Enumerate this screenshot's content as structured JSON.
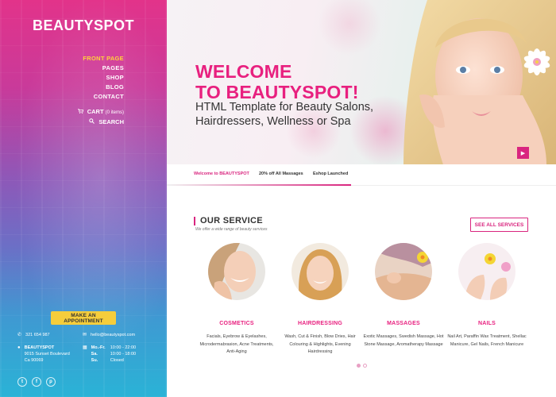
{
  "brand": "BEAUTYSPOT",
  "menu": {
    "items": [
      "FRONT PAGE",
      "PAGES",
      "SHOP",
      "BLOG",
      "CONTACT"
    ],
    "cart_label": "CART",
    "cart_count": "(0 items)",
    "search_label": "SEARCH"
  },
  "appointment_button": "MAKE AN APPOINTMENT",
  "contact": {
    "phone": "321 654 987",
    "email": "hello@beautyspot.com",
    "address": [
      "BEAUTYSPOT",
      "9015 Sunset Boulevard",
      "Ca 90069"
    ],
    "hours": [
      {
        "day": "Mo.-Fr.",
        "time": "10:00 - 22:00"
      },
      {
        "day": "Sa.",
        "time": "10:00 - 18:00"
      },
      {
        "day": "Su.",
        "time": "Closed"
      }
    ]
  },
  "social": [
    "t",
    "f",
    "p"
  ],
  "hero": {
    "title_line1": "WELCOME",
    "title_line2": "TO BEAUTYSPOT!",
    "subtitle": "HTML Template for Beauty Salons, Hairdressers, Wellness or Spa"
  },
  "ticker": [
    "Welcome to BEAUTYSPOT",
    "20% off All Massages",
    "Eshop Launched"
  ],
  "services": {
    "title": "OUR SERVICE",
    "subtitle": "We offer a wide range of beauty services",
    "see_all": "SEE ALL SERVICES",
    "items": [
      {
        "name": "COSMETICS",
        "desc": "Facials, Eyebrow & Eyelashes, Microdermabrasion, Acne Treatments, Anti-Aging"
      },
      {
        "name": "HAIRDRESSING",
        "desc": "Wash, Cut & Finish, Blow Dries, Hair Colouring & Highlights, Evening Hairdressing"
      },
      {
        "name": "MASSAGES",
        "desc": "Exotic Massages, Swedish Massage, Hot Stone Massage, Aromatherapy Massage"
      },
      {
        "name": "NAILS",
        "desc": "Nail Art, Paraffin Wax Treatment, Shellac Manicure, Gel Nails, French Manicure"
      }
    ]
  },
  "colors": {
    "accent": "#e8207f",
    "button_yellow": "#f5cd3c",
    "sidebar_top": "#e2338a",
    "sidebar_bottom": "#2ab3d6"
  }
}
